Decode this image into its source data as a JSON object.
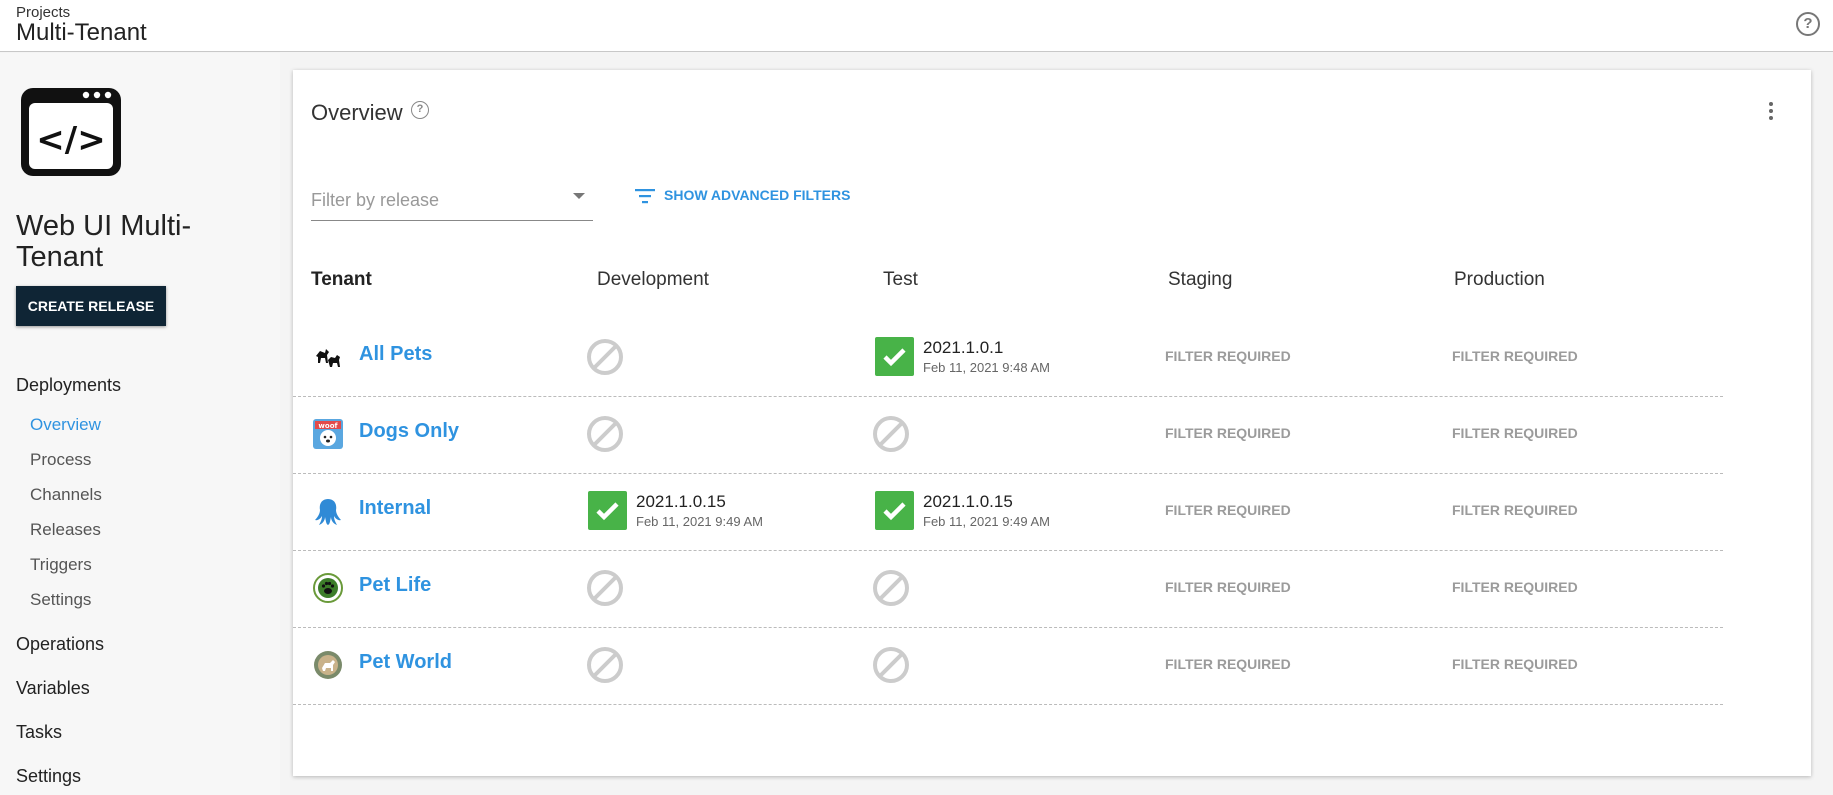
{
  "header": {
    "breadcrumb": "Projects",
    "title": "Multi-Tenant",
    "help_icon": "help-circle-icon"
  },
  "sidebar": {
    "project_name": "Web UI Multi-Tenant",
    "create_release_label": "CREATE RELEASE",
    "deployments_label": "Deployments",
    "deployments_items": [
      {
        "label": "Overview",
        "active": true
      },
      {
        "label": "Process"
      },
      {
        "label": "Channels"
      },
      {
        "label": "Releases"
      },
      {
        "label": "Triggers"
      },
      {
        "label": "Settings"
      }
    ],
    "sections": [
      {
        "label": "Operations"
      },
      {
        "label": "Variables"
      },
      {
        "label": "Tasks"
      },
      {
        "label": "Settings"
      }
    ]
  },
  "overview": {
    "title": "Overview",
    "filter_placeholder": "Filter by release",
    "advanced_filters_label": "SHOW ADVANCED FILTERS",
    "columns": [
      "Tenant",
      "Development",
      "Test",
      "Staging",
      "Production"
    ],
    "rows": [
      {
        "tenant": "All Pets",
        "avatar": "dogs-silhouette-icon",
        "development": {
          "status": "none"
        },
        "test": {
          "status": "success",
          "version": "2021.1.0.1",
          "date": "Feb 11, 2021 9:48 AM"
        },
        "staging": {
          "text": "FILTER REQUIRED"
        },
        "production": {
          "text": "FILTER REQUIRED"
        }
      },
      {
        "tenant": "Dogs Only",
        "avatar": "woof-dog-icon",
        "development": {
          "status": "none"
        },
        "test": {
          "status": "none"
        },
        "staging": {
          "text": "FILTER REQUIRED"
        },
        "production": {
          "text": "FILTER REQUIRED"
        }
      },
      {
        "tenant": "Internal",
        "avatar": "octopus-icon",
        "development": {
          "status": "success",
          "version": "2021.1.0.15",
          "date": "Feb 11, 2021 9:49 AM"
        },
        "test": {
          "status": "success",
          "version": "2021.1.0.15",
          "date": "Feb 11, 2021 9:49 AM"
        },
        "staging": {
          "text": "FILTER REQUIRED"
        },
        "production": {
          "text": "FILTER REQUIRED"
        }
      },
      {
        "tenant": "Pet Life",
        "avatar": "paw-badge-icon",
        "development": {
          "status": "none"
        },
        "test": {
          "status": "none"
        },
        "staging": {
          "text": "FILTER REQUIRED"
        },
        "production": {
          "text": "FILTER REQUIRED"
        }
      },
      {
        "tenant": "Pet World",
        "avatar": "globe-dog-icon",
        "development": {
          "status": "none"
        },
        "test": {
          "status": "none"
        },
        "staging": {
          "text": "FILTER REQUIRED"
        },
        "production": {
          "text": "FILTER REQUIRED"
        }
      }
    ]
  },
  "colors": {
    "accent": "#2f93e0",
    "success": "#48b348",
    "button_dark": "#0f2535",
    "muted": "#9b9b9b"
  }
}
